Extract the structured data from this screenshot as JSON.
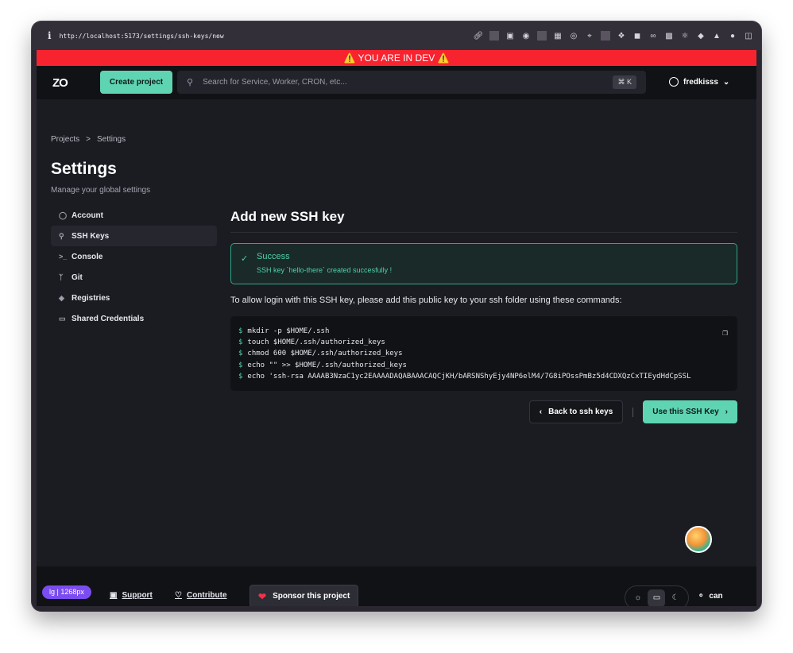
{
  "browser": {
    "url": "http://localhost:5173/settings/ssh-keys/new",
    "info_icon": "i"
  },
  "dev_banner": "⚠️ YOU ARE IN DEV ⚠️",
  "topnav": {
    "logo": "ZO",
    "create_project": "Create project",
    "search_placeholder": "Search for Service, Worker, CRON, etc...",
    "shortcut": "⌘ K",
    "username": "fredkisss"
  },
  "breadcrumb": {
    "items": [
      "Projects",
      "Settings"
    ],
    "separator": ">"
  },
  "page": {
    "title": "Settings",
    "subtitle": "Manage your global settings"
  },
  "sidebar": {
    "items": [
      {
        "label": "Account",
        "icon": "user-icon"
      },
      {
        "label": "SSH Keys",
        "icon": "key-icon",
        "active": true
      },
      {
        "label": "Console",
        "icon": "terminal-icon"
      },
      {
        "label": "Git",
        "icon": "git-branch-icon"
      },
      {
        "label": "Registries",
        "icon": "layers-icon"
      },
      {
        "label": "Shared Credentials",
        "icon": "credit-card-icon"
      }
    ]
  },
  "main": {
    "title": "Add new SSH key",
    "alert": {
      "title": "Success",
      "message": "SSH key `hello-there` created succesfully !"
    },
    "instructions": "To allow login with this SSH key, please add this public key to your ssh folder using these commands:",
    "commands": [
      "mkdir -p $HOME/.ssh",
      "touch $HOME/.ssh/authorized_keys",
      "chmod 600 $HOME/.ssh/authorized_keys",
      "echo \"\" >> $HOME/.ssh/authorized_keys",
      "echo 'ssh-rsa AAAAB3NzaC1yc2EAAAADAQABAAACAQCjKH/bARSNShyEjy4NP6elM4/7G8iPOssPmBz5d4CDXQzCxTIEydHdCpSSL"
    ],
    "prompt": "$",
    "back_button": "Back to ssh keys",
    "use_button": "Use this SSH Key"
  },
  "footer": {
    "breakpoint_badge": "lg | 1268px",
    "support": "Support",
    "contribute": "Contribute",
    "sponsor": "Sponsor this project",
    "tag_label": "can"
  },
  "colors": {
    "accent": "#5fd4b3",
    "dev_banner": "#f7232f",
    "success": "#4fcfaa"
  }
}
